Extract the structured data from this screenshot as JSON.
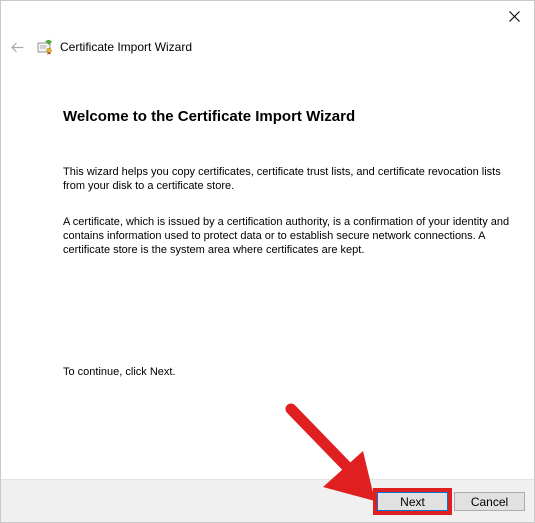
{
  "window": {
    "title": "Certificate Import Wizard"
  },
  "content": {
    "heading": "Welcome to the Certificate Import Wizard",
    "paragraph_1": "This wizard helps you copy certificates, certificate trust lists, and certificate revocation lists from your disk to a certificate store.",
    "paragraph_2": "A certificate, which is issued by a certification authority, is a confirmation of your identity and contains information used to protect data or to establish secure network connections. A certificate store is the system area where certificates are kept.",
    "paragraph_3": "To continue, click Next."
  },
  "footer": {
    "next_label": "Next",
    "cancel_label": "Cancel"
  },
  "icons": {
    "close": "close-icon",
    "back": "back-arrow-icon",
    "wizard": "certificate-icon",
    "annotation": "red-arrow-annotation"
  },
  "colors": {
    "highlight": "#e02020",
    "footer_bg": "#f0f0f0",
    "button_bg": "#e1e1e1"
  }
}
